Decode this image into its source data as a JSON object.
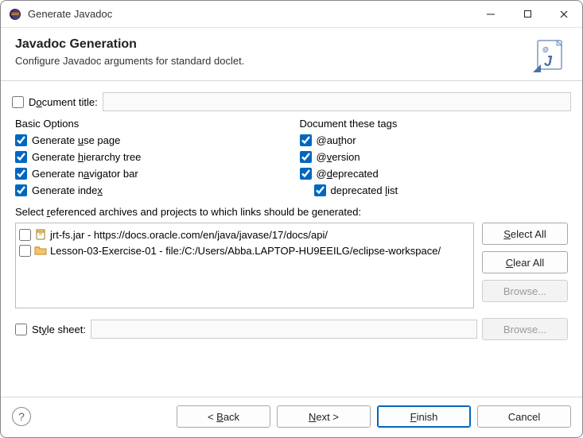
{
  "window": {
    "title": "Generate Javadoc"
  },
  "banner": {
    "heading": "Javadoc Generation",
    "subtitle": "Configure Javadoc arguments for standard doclet."
  },
  "doc_title": {
    "label_pre": "D",
    "label_u": "o",
    "label_post": "cument title:",
    "checked": false,
    "value": ""
  },
  "basic_options": {
    "legend": "Basic Options",
    "items": [
      {
        "checked": true,
        "pre": "Generate ",
        "u": "u",
        "post": "se page"
      },
      {
        "checked": true,
        "pre": "Generate ",
        "u": "h",
        "post": "ierarchy tree"
      },
      {
        "checked": true,
        "pre": "Generate n",
        "u": "a",
        "post": "vigator bar"
      },
      {
        "checked": true,
        "pre": "Generate inde",
        "u": "x",
        "post": ""
      }
    ]
  },
  "doc_tags": {
    "legend": "Document these tags",
    "items": [
      {
        "checked": true,
        "pre": "@au",
        "u": "t",
        "post": "hor",
        "indent": false
      },
      {
        "checked": true,
        "pre": "@",
        "u": "v",
        "post": "ersion",
        "indent": false
      },
      {
        "checked": true,
        "pre": "@",
        "u": "d",
        "post": "eprecated",
        "indent": false
      },
      {
        "checked": true,
        "pre": "deprecated ",
        "u": "l",
        "post": "ist",
        "indent": true
      }
    ]
  },
  "referenced": {
    "label_pre": "Select ",
    "label_u": "r",
    "label_post": "eferenced archives and projects to which links should be generated:",
    "items": [
      {
        "checked": false,
        "icon": "jar",
        "text": "jrt-fs.jar - https://docs.oracle.com/en/java/javase/17/docs/api/"
      },
      {
        "checked": false,
        "icon": "folder",
        "text": "Lesson-03-Exercise-01 - file:/C:/Users/Abba.LAPTOP-HU9EEILG/eclipse-workspace/"
      }
    ],
    "buttons": {
      "select_all_pre": "",
      "select_all_u": "S",
      "select_all_post": "elect All",
      "clear_all_pre": "",
      "clear_all_u": "C",
      "clear_all_post": "lear All",
      "browse": "Browse..."
    }
  },
  "stylesheet": {
    "label_pre": "St",
    "label_u": "y",
    "label_post": "le sheet:",
    "checked": false,
    "value": "",
    "browse": "Browse..."
  },
  "footer": {
    "back_pre": "< ",
    "back_u": "B",
    "back_post": "ack",
    "next_pre": "",
    "next_u": "N",
    "next_post": "ext >",
    "finish_pre": "",
    "finish_u": "F",
    "finish_post": "inish",
    "cancel": "Cancel"
  }
}
